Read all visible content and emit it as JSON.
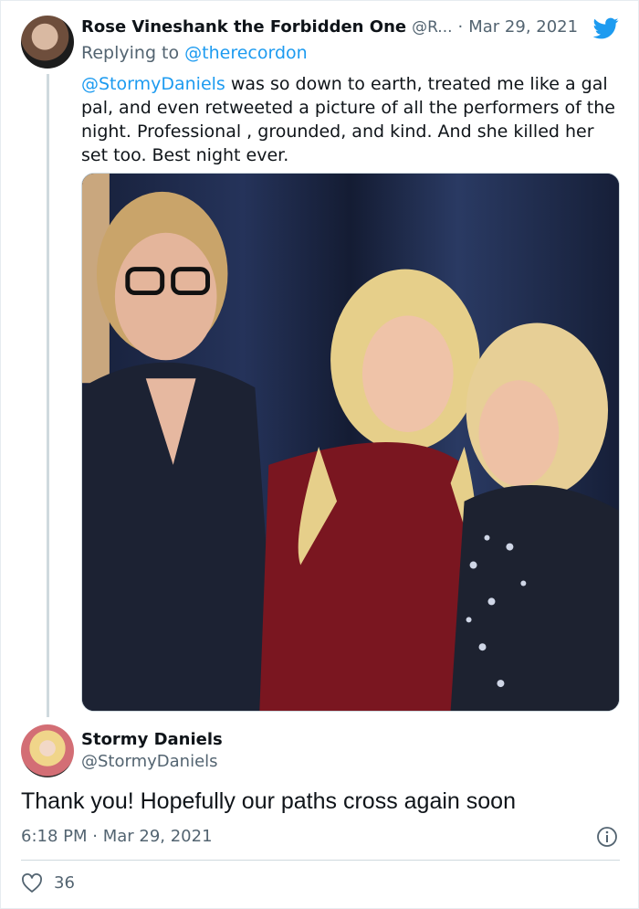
{
  "reply_tweet": {
    "display_name": "Rose Vineshank the Forbidden One",
    "handle": "@R...",
    "separator": "·",
    "date": "Mar 29, 2021",
    "replying_prefix": "Replying to ",
    "replying_to": "@therecordon",
    "mention": "@StormyDaniels",
    "text": " was so down to earth, treated me like a gal pal, and even retweeted a picture of all the performers of the night. Professional , grounded, and kind.  And she killed her set too. Best night ever."
  },
  "main_tweet": {
    "display_name": "Stormy Daniels",
    "handle": "@StormyDaniels",
    "text": "Thank you! Hopefully our paths cross again soon",
    "timestamp": "6:18 PM · Mar 29, 2021",
    "like_count": "36"
  },
  "icons": {
    "brand": "twitter-bird-icon",
    "info": "info-icon",
    "like": "heart-icon"
  },
  "colors": {
    "link": "#1d9bf0",
    "secondary_text": "#536471",
    "primary_text": "#0f1419",
    "divider": "#cfd9de"
  }
}
